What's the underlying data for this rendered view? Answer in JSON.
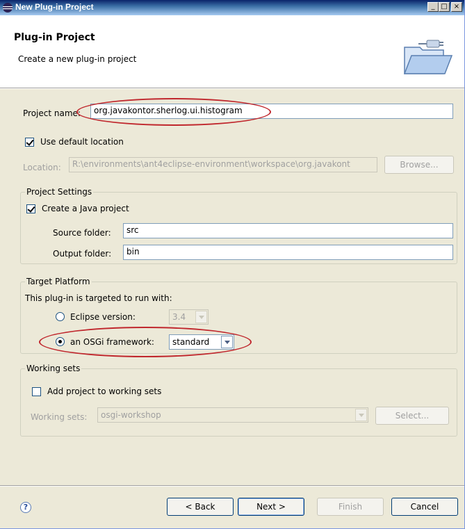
{
  "window": {
    "title": "New Plug-in Project",
    "controls": {
      "minimize": "_",
      "maximize": "□",
      "close": "×"
    }
  },
  "header": {
    "title": "Plug-in Project",
    "subtitle": "Create a new plug-in project",
    "banner_icon": "folder-plug-icon"
  },
  "project": {
    "name_label": "Project name:",
    "name_value": "org.javakontor.sherlog.ui.histogram",
    "use_default_label": "Use default location",
    "use_default_checked": true,
    "location_label": "Location:",
    "location_value": "R:\\environments\\ant4eclipse-environment\\workspace\\org.javakont",
    "browse_label": "Browse..."
  },
  "project_settings": {
    "group_title": "Project Settings",
    "create_java_label": "Create a Java project",
    "create_java_checked": true,
    "source_label": "Source folder:",
    "source_value": "src",
    "output_label": "Output folder:",
    "output_value": "bin"
  },
  "target_platform": {
    "group_title": "Target Platform",
    "intro": "This plug-in is targeted to run with:",
    "eclipse_label": "Eclipse version:",
    "eclipse_value": "3.4",
    "osgi_label": "an OSGi framework:",
    "osgi_value": "standard",
    "selected": "osgi"
  },
  "working_sets": {
    "group_title": "Working sets",
    "add_label": "Add project to working sets",
    "add_checked": false,
    "sets_label": "Working sets:",
    "sets_value": "osgi-workshop",
    "select_label": "Select..."
  },
  "footer": {
    "help_glyph": "?",
    "back_label": "< Back",
    "next_label": "Next >",
    "finish_label": "Finish",
    "cancel_label": "Cancel"
  },
  "colors": {
    "highlight_oval": "#c0272d",
    "dialog_bg": "#ece9d8",
    "titlebar": "#0a246a"
  }
}
